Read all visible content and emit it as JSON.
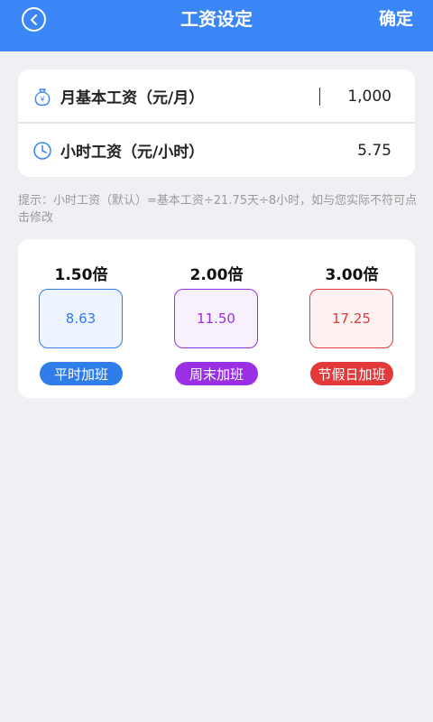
{
  "header": {
    "title": "工资设定",
    "confirm_label": "确定",
    "back_icon": "chevron-left-icon"
  },
  "salary": {
    "monthly": {
      "label": "月基本工资（元/月）",
      "value": "1,000",
      "icon": "money-bag-icon"
    },
    "hourly": {
      "label": "小时工资（元/小时）",
      "value": "5.75",
      "icon": "clock-icon"
    }
  },
  "hint": "提示：小时工资（默认）=基本工资÷21.75天÷8小时，如与您实际不符可点击修改",
  "overtime": [
    {
      "multiplier": "1.50倍",
      "value": "8.63",
      "label": "平时加班",
      "color": "#2f7de8",
      "bg": "#eef4fd"
    },
    {
      "multiplier": "2.00倍",
      "value": "11.50",
      "label": "周末加班",
      "color": "#9a2fe6",
      "bg": "#f8f1fd"
    },
    {
      "multiplier": "3.00倍",
      "value": "17.25",
      "label": "节假日加班",
      "color": "#e23a3a",
      "bg": "#fdf1f1"
    }
  ],
  "colors": {
    "primary": "#3b86f7",
    "background": "#efeff4"
  }
}
